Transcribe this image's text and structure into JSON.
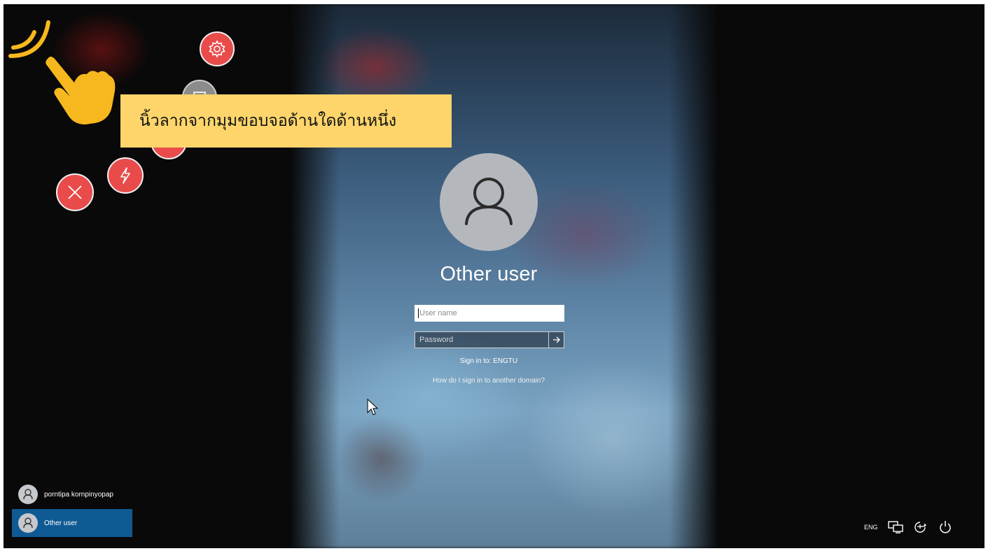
{
  "gesture_overlay": {
    "instruction_text": "นิ้วลากจากมุมขอบจอด้านใดด้านหนึ่ง",
    "bubbles": [
      "gear-icon",
      "monitor-icon",
      "circle",
      "bolt-icon",
      "close-icon"
    ],
    "colors": {
      "bubble_red": "#e94b4b",
      "instruction_bg": "#fdd56b",
      "hand_yellow": "#f6b81e"
    }
  },
  "login": {
    "title": "Other user",
    "username_placeholder": "User name",
    "password_placeholder": "Password",
    "submit_icon": "arrow-right-icon",
    "sign_in_to": "Sign in to: ENGTU",
    "domain_help": "How do I sign in to another domain?"
  },
  "users": [
    {
      "name": "porntipa kornpinyopap",
      "selected": false
    },
    {
      "name": "Other user",
      "selected": true
    }
  ],
  "tray": {
    "language": "ENG",
    "icons": [
      "network-icon",
      "ease-of-access-icon",
      "power-icon"
    ]
  },
  "colors": {
    "selected_user_bg": "#0f5a93",
    "screen_bg": "#090909"
  }
}
